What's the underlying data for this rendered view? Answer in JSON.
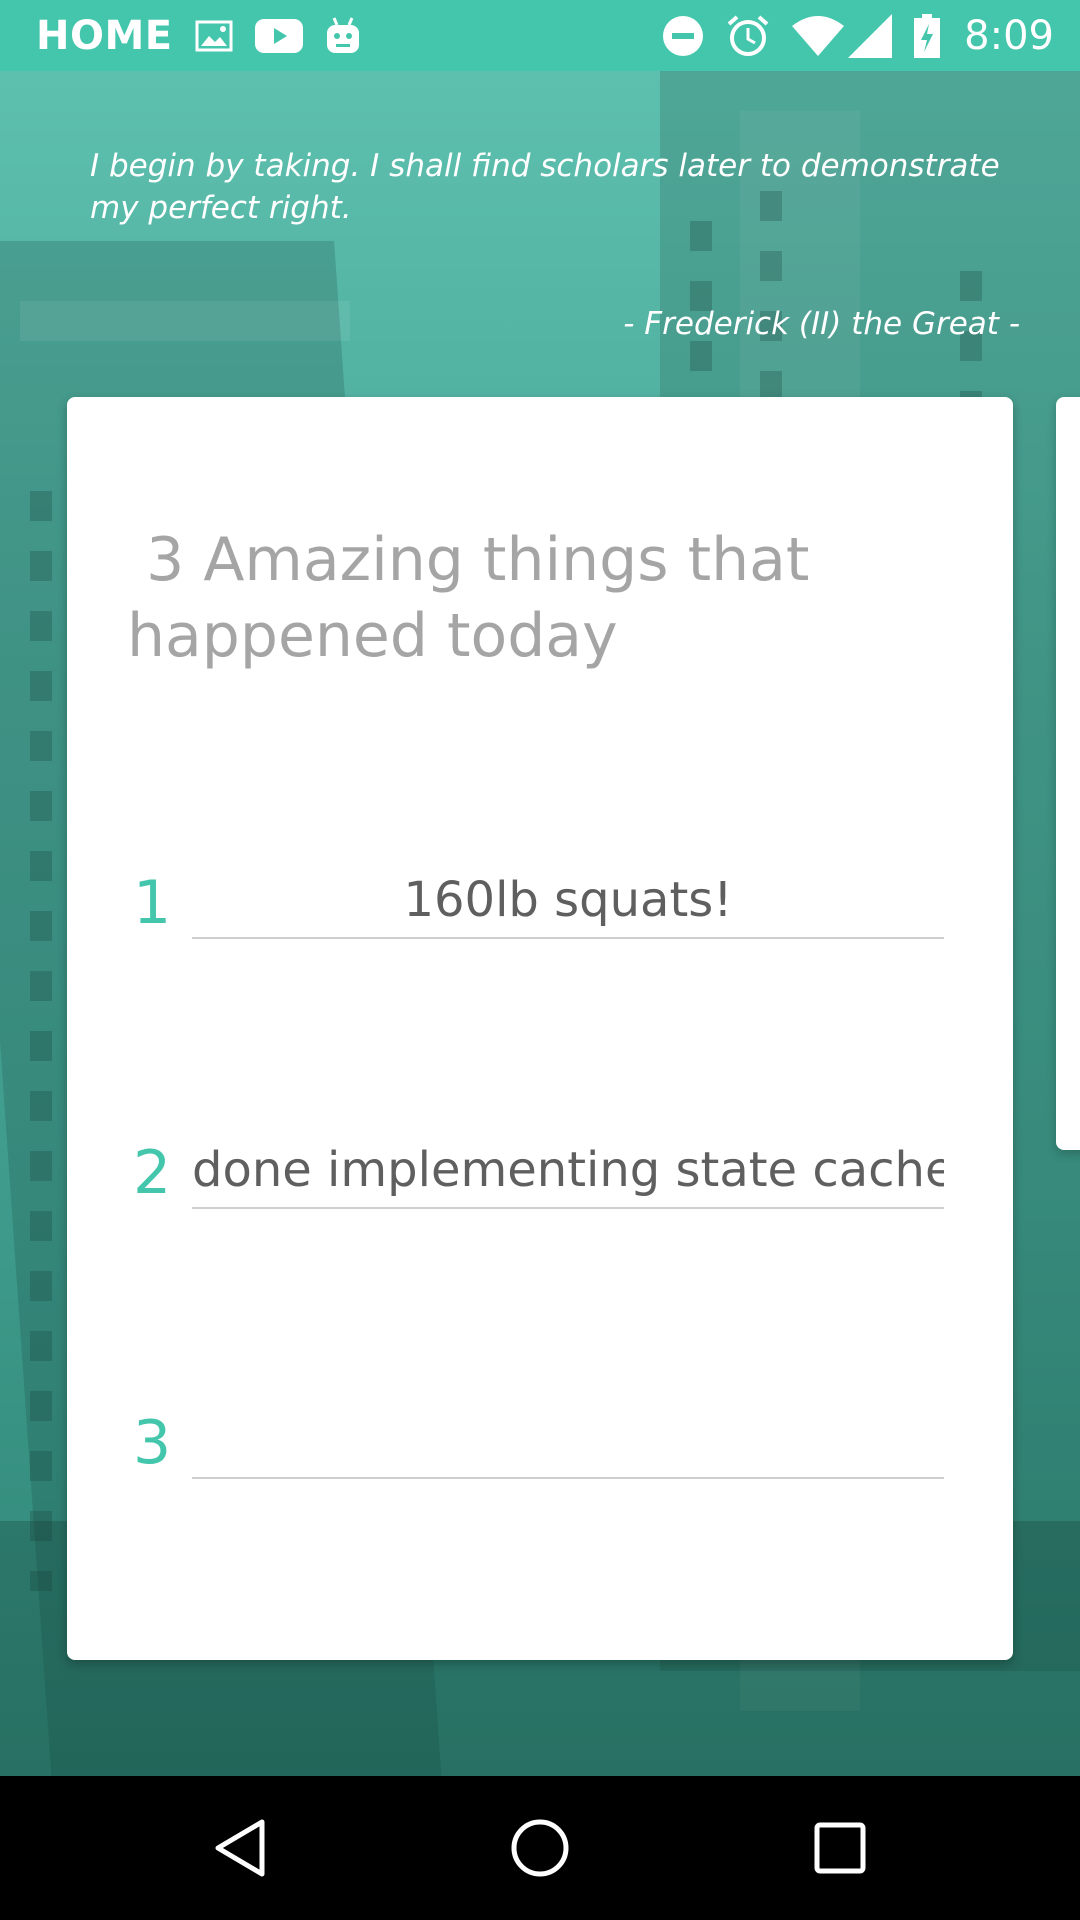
{
  "status_bar": {
    "app_label": "HOME",
    "time": "8:09",
    "icons_left": [
      "image-icon",
      "youtube-icon",
      "android-icon"
    ],
    "icons_right": [
      "do-not-disturb-icon",
      "alarm-icon",
      "wifi-icon",
      "signal-icon",
      "battery-charging-icon"
    ],
    "color": "#43c6ac"
  },
  "quote": {
    "text": "I begin by taking. I shall find scholars later to demonstrate my perfect right.",
    "author": "- Frederick (II) the Great -"
  },
  "card": {
    "title": " 3 Amazing things that\nhappened today",
    "entries": [
      {
        "number": "1",
        "value": "160lb squats!"
      },
      {
        "number": "2",
        "value": "done implementing state cache"
      },
      {
        "number": "3",
        "value": ""
      }
    ],
    "accent_color": "#43c6ac"
  },
  "nav_bar": {
    "buttons": [
      "back-icon",
      "home-icon",
      "recents-icon"
    ]
  }
}
